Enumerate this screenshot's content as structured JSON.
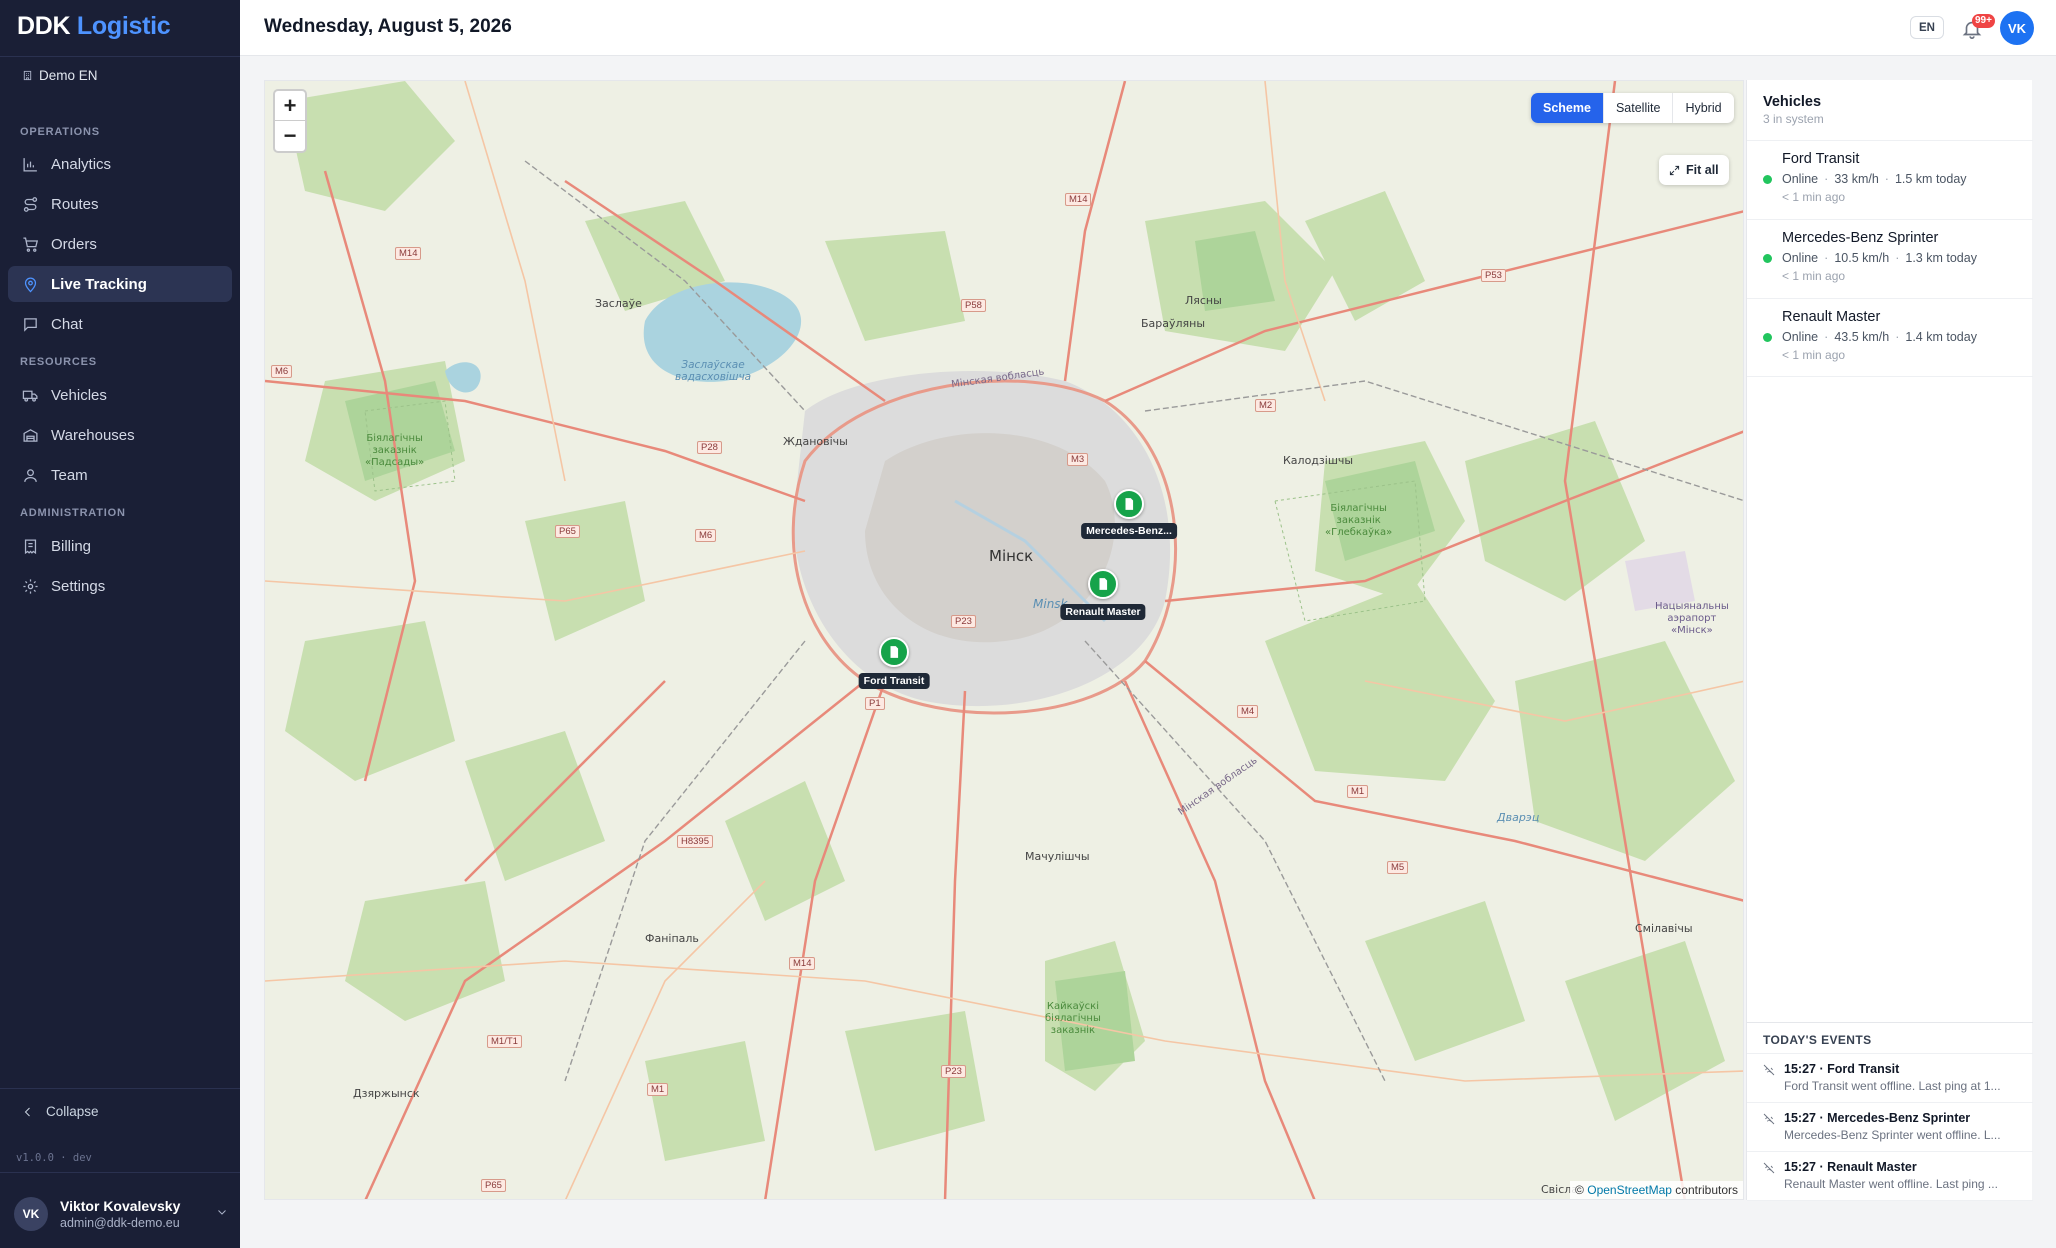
{
  "brand": {
    "part1": "DDK",
    "part2": "Logistic"
  },
  "org": "Demo EN",
  "sections": {
    "operations": "OPERATIONS",
    "resources": "RESOURCES",
    "administration": "ADMINISTRATION"
  },
  "nav": {
    "analytics": "Analytics",
    "routes": "Routes",
    "orders": "Orders",
    "live_tracking": "Live Tracking",
    "chat": "Chat",
    "vehicles": "Vehicles",
    "warehouses": "Warehouses",
    "team": "Team",
    "billing": "Billing",
    "settings": "Settings"
  },
  "active_nav": "live_tracking",
  "collapse_label": "Collapse",
  "version": "v1.0.0 · dev",
  "user": {
    "initials": "VK",
    "name": "Viktor Kovalevsky",
    "email": "admin@ddk-demo.eu"
  },
  "header": {
    "date": "Wednesday, August 5, 2026",
    "lang": "EN",
    "notifications": "99+",
    "avatar": "VK"
  },
  "map": {
    "zoom_in": "+",
    "zoom_out": "−",
    "types": [
      "Scheme",
      "Satellite",
      "Hybrid"
    ],
    "selected_type": "Scheme",
    "fit_all": "Fit all",
    "attribution_prefix": "©",
    "attribution_link": "OpenStreetMap",
    "attribution_suffix": "contributors",
    "labels": {
      "minsk": "Мінск",
      "minsk2": "Minsk",
      "zaslauye": "Заслаўе",
      "reservoir": "Заслаўскае\nвадасховішча",
      "zhdanovichy": "Ждановічы",
      "lyasny": "Лясны",
      "barauliany": "Бараўляны",
      "kalodzishchy": "Калодзішчы",
      "machulishchy": "Мачулішчы",
      "fanipal": "Фаніпаль",
      "dzyarzhynsk": "Дзяржынск",
      "smilavichy": "Смілавічы",
      "svislach": "Свіслач",
      "airport": "Нацыянальны\nаэрапорт\n«Мінск»",
      "podsady": "Біялагічны\nзаказнік\n«Падсады»",
      "glebkauka": "Біялагічны\nзаказнік\n«Глебкаўка»",
      "kaikauski": "Кайкаўскі\nбіялагічны\nзаказнік",
      "dvarets": "Дварэц",
      "minsk_ring": "Мінская вобласць",
      "minsk_region": "Мінская вобласць"
    },
    "roads": [
      "M14",
      "M14",
      "P58",
      "P53",
      "M6",
      "M2",
      "P28",
      "M3",
      "P65",
      "M6",
      "P23",
      "M4",
      "P1",
      "M1",
      "M5",
      "H8395",
      "M14",
      "M1/T1",
      "M1",
      "P23",
      "P65"
    ]
  },
  "markers": [
    {
      "name": "Ford Transit",
      "label": "Ford Transit"
    },
    {
      "name": "Mercedes-Benz Sprinter",
      "label": "Mercedes-Benz..."
    },
    {
      "name": "Renault Master",
      "label": "Renault Master"
    }
  ],
  "panel": {
    "title": "Vehicles",
    "subtitle": "3 in system",
    "vehicles": [
      {
        "name": "Ford Transit",
        "status": "Online",
        "speed": "33 km/h",
        "distance": "1.5 km today",
        "last_seen": "< 1 min ago",
        "status_color": "#22c55e"
      },
      {
        "name": "Mercedes-Benz Sprinter",
        "status": "Online",
        "speed": "10.5 km/h",
        "distance": "1.3 km today",
        "last_seen": "< 1 min ago",
        "status_color": "#22c55e"
      },
      {
        "name": "Renault Master",
        "status": "Online",
        "speed": "43.5 km/h",
        "distance": "1.4 km today",
        "last_seen": "< 1 min ago",
        "status_color": "#22c55e"
      }
    ],
    "events_title": "TODAY'S EVENTS",
    "events": [
      {
        "title": "15:27 · Ford Transit",
        "desc": "Ford Transit went offline. Last ping at 1..."
      },
      {
        "title": "15:27 · Mercedes-Benz Sprinter",
        "desc": "Mercedes-Benz Sprinter went offline. L..."
      },
      {
        "title": "15:27 · Renault Master",
        "desc": "Renault Master went offline. Last ping ..."
      }
    ]
  },
  "colors": {
    "accent": "#2563eb",
    "sidebar_bg": "#1a1f36",
    "online": "#22c55e",
    "marker": "#16a34a",
    "brand_blue": "#4e93ff"
  }
}
